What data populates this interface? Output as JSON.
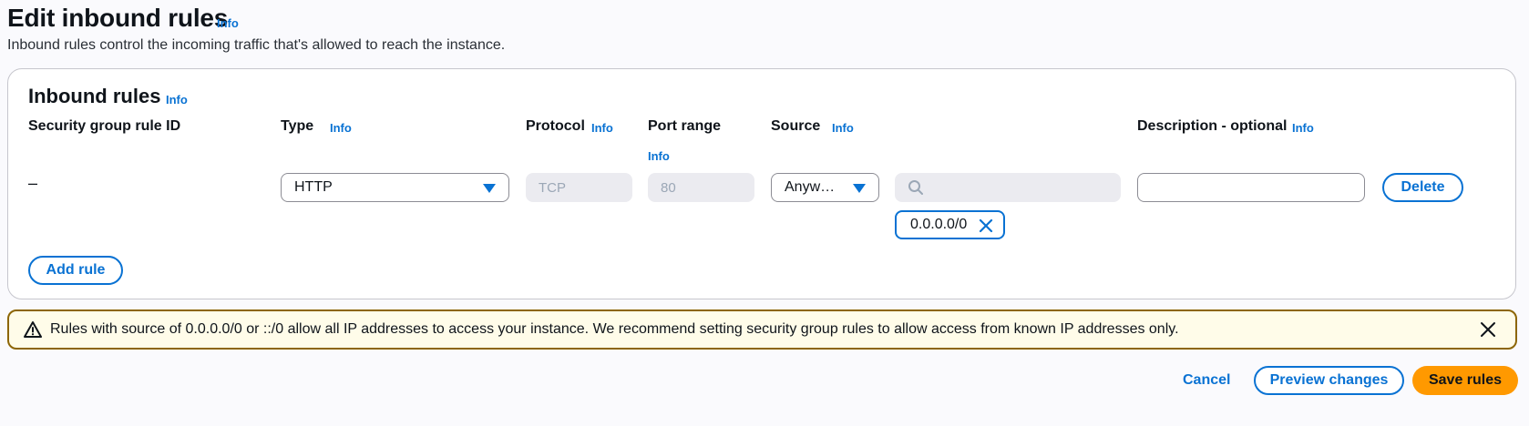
{
  "page": {
    "title": "Edit inbound rules",
    "title_info": "Info",
    "description": "Inbound rules control the incoming traffic that's allowed to reach the instance."
  },
  "panel": {
    "title": "Inbound rules",
    "title_info": "Info",
    "columns": {
      "rule_id": "Security group rule ID",
      "type": "Type",
      "type_info": "Info",
      "protocol": "Protocol",
      "protocol_info": "Info",
      "port_range": "Port range",
      "port_range_info": "Info",
      "source": "Source",
      "source_info": "Info",
      "description": "Description - optional",
      "description_info": "Info"
    },
    "rows": [
      {
        "rule_id": "–",
        "type": "HTTP",
        "protocol_placeholder": "TCP",
        "port_range_placeholder": "80",
        "source": "Anyw…",
        "source_search_value": "",
        "source_token": "0.0.0.0/0",
        "description_value": "",
        "delete_label": "Delete"
      }
    ],
    "add_rule_label": "Add rule"
  },
  "alert": {
    "type": "warning",
    "text": "Rules with source of 0.0.0.0/0 or ::/0 allow all IP addresses to access your instance. We recommend setting security group rules to allow access from known IP addresses only."
  },
  "footer": {
    "cancel_label": "Cancel",
    "preview_label": "Preview changes",
    "save_label": "Save rules"
  },
  "colors": {
    "link": "#0972d3",
    "primary_button": "#ff9900",
    "warning_border": "#8d6605",
    "warning_bg": "#fffce9"
  },
  "icons": {
    "type_caret": "caret-down-icon",
    "source_caret": "caret-down-icon",
    "search": "search-icon",
    "token_remove": "close-icon",
    "alert": "warning-icon",
    "alert_close": "close-icon"
  }
}
